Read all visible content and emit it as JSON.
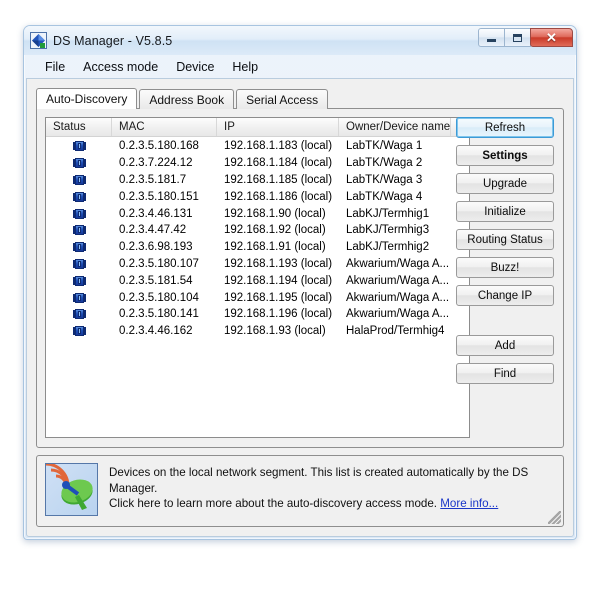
{
  "window": {
    "title": "DS Manager - V5.8.5",
    "icon": "ds-manager-diamond-icon",
    "controls": {
      "minimize": "–",
      "maximize": "□",
      "close": "✕"
    }
  },
  "menu": {
    "items": [
      {
        "label": "File"
      },
      {
        "label": "Access mode"
      },
      {
        "label": "Device"
      },
      {
        "label": "Help"
      }
    ]
  },
  "tabs": [
    {
      "label": "Auto-Discovery",
      "active": true
    },
    {
      "label": "Address Book",
      "active": false
    },
    {
      "label": "Serial Access",
      "active": false
    }
  ],
  "list": {
    "columns": [
      {
        "key": "status",
        "label": "Status"
      },
      {
        "key": "mac",
        "label": "MAC"
      },
      {
        "key": "ip",
        "label": "IP"
      },
      {
        "key": "owner",
        "label": "Owner/Device name"
      },
      {
        "key": "extra",
        "label": ""
      }
    ],
    "rows": [
      {
        "status": "device-online-icon",
        "mac": "0.2.3.5.180.168",
        "ip": "192.168.1.183 (local)",
        "owner": "LabTK/Waga 1"
      },
      {
        "status": "device-online-icon",
        "mac": "0.2.3.7.224.12",
        "ip": "192.168.1.184 (local)",
        "owner": "LabTK/Waga 2"
      },
      {
        "status": "device-online-icon",
        "mac": "0.2.3.5.181.7",
        "ip": "192.168.1.185 (local)",
        "owner": "LabTK/Waga 3"
      },
      {
        "status": "device-online-icon",
        "mac": "0.2.3.5.180.151",
        "ip": "192.168.1.186 (local)",
        "owner": "LabTK/Waga 4"
      },
      {
        "status": "device-online-icon",
        "mac": "0.2.3.4.46.131",
        "ip": "192.168.1.90 (local)",
        "owner": "LabKJ/Termhig1"
      },
      {
        "status": "device-online-icon",
        "mac": "0.2.3.4.47.42",
        "ip": "192.168.1.92 (local)",
        "owner": "LabKJ/Termhig3"
      },
      {
        "status": "device-online-icon",
        "mac": "0.2.3.6.98.193",
        "ip": "192.168.1.91 (local)",
        "owner": "LabKJ/Termhig2"
      },
      {
        "status": "device-online-icon",
        "mac": "0.2.3.5.180.107",
        "ip": "192.168.1.193 (local)",
        "owner": "Akwarium/Waga A..."
      },
      {
        "status": "device-online-icon",
        "mac": "0.2.3.5.181.54",
        "ip": "192.168.1.194 (local)",
        "owner": "Akwarium/Waga A..."
      },
      {
        "status": "device-online-icon",
        "mac": "0.2.3.5.180.104",
        "ip": "192.168.1.195 (local)",
        "owner": "Akwarium/Waga A..."
      },
      {
        "status": "device-online-icon",
        "mac": "0.2.3.5.180.141",
        "ip": "192.168.1.196 (local)",
        "owner": "Akwarium/Waga A..."
      },
      {
        "status": "device-online-icon",
        "mac": "0.2.3.4.46.162",
        "ip": "192.168.1.93 (local)",
        "owner": "HalaProd/Termhig4"
      }
    ]
  },
  "buttons": {
    "primary": [
      {
        "label": "Refresh",
        "state": "focused"
      },
      {
        "label": "Settings",
        "state": "default"
      },
      {
        "label": "Upgrade",
        "state": "normal"
      },
      {
        "label": "Initialize",
        "state": "normal"
      },
      {
        "label": "Routing Status",
        "state": "normal"
      },
      {
        "label": "Buzz!",
        "state": "normal"
      },
      {
        "label": "Change IP",
        "state": "normal"
      }
    ],
    "secondary": [
      {
        "label": "Add",
        "state": "normal"
      },
      {
        "label": "Find",
        "state": "normal"
      }
    ]
  },
  "info": {
    "icon": "satellite-dish-icon",
    "line1": "Devices on the local network segment. This list is created automatically by the DS Manager.",
    "line2": "Click here to learn more about the auto-discovery access mode.",
    "link": "More info..."
  },
  "colors": {
    "accent": "#1d4fb5",
    "focus_border": "#3c9ad6",
    "link": "#1a36c8",
    "close_button": "#ca3a29",
    "titlebar": "#dceaf8"
  }
}
